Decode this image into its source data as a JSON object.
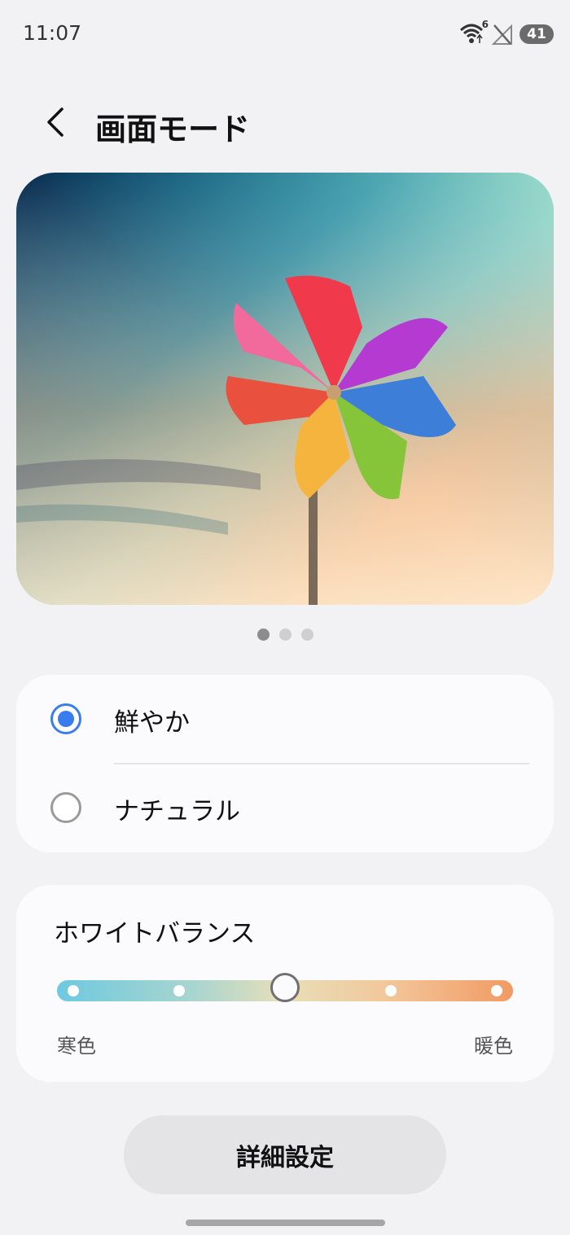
{
  "status_bar": {
    "time": "11:07",
    "wifi_badge": "6",
    "battery": "41"
  },
  "header": {
    "back_icon": "chevron-left-icon",
    "title": "画面モード"
  },
  "preview": {
    "image": "pinwheel-sky-photo",
    "page_count": 3,
    "active_page": 1
  },
  "screen_mode": {
    "options": [
      {
        "label": "鮮やか",
        "selected": true
      },
      {
        "label": "ナチュラル",
        "selected": false
      }
    ]
  },
  "white_balance": {
    "title": "ホワイトバランス",
    "min_label": "寒色",
    "max_label": "暖色",
    "steps": 5,
    "value_step": 3
  },
  "footer": {
    "advanced_label": "詳細設定"
  },
  "colors": {
    "accent": "#3a7cf0",
    "background": "#f2f2f4",
    "card": "#fbfbfd"
  }
}
